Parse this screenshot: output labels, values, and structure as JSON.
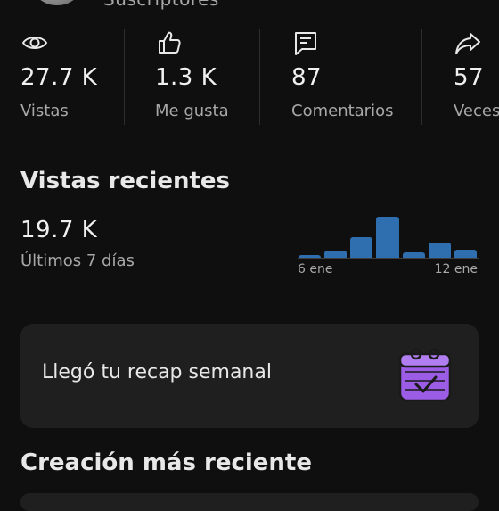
{
  "header": {
    "subscribers_label": "Suscriptores"
  },
  "stats": [
    {
      "icon": "eye-icon",
      "value": "27.7 K",
      "label": "Vistas"
    },
    {
      "icon": "thumbs-up-icon",
      "value": "1.3 K",
      "label": "Me gusta"
    },
    {
      "icon": "comment-icon",
      "value": "87",
      "label": "Comentarios"
    },
    {
      "icon": "share-icon",
      "value": "57",
      "label": "Veces"
    }
  ],
  "recent_views": {
    "title": "Vistas recientes",
    "value": "19.7 K",
    "period": "Últimos 7 días"
  },
  "chart_data": {
    "type": "bar",
    "categories": [
      "6 ene",
      "",
      "",
      "",
      "",
      "",
      "12 ene"
    ],
    "values": [
      0.8,
      2.4,
      6.5,
      13.1,
      1.6,
      4.7,
      2.6
    ],
    "x_tick_labels": [
      "6 ene",
      "12 ene"
    ],
    "color": "#2f6fb0"
  },
  "recap": {
    "text": "Llegó tu recap semanal",
    "icon": "calendar-check-icon",
    "icon_color": "#9b5de5"
  },
  "latest_creation": {
    "title": "Creación más reciente"
  }
}
